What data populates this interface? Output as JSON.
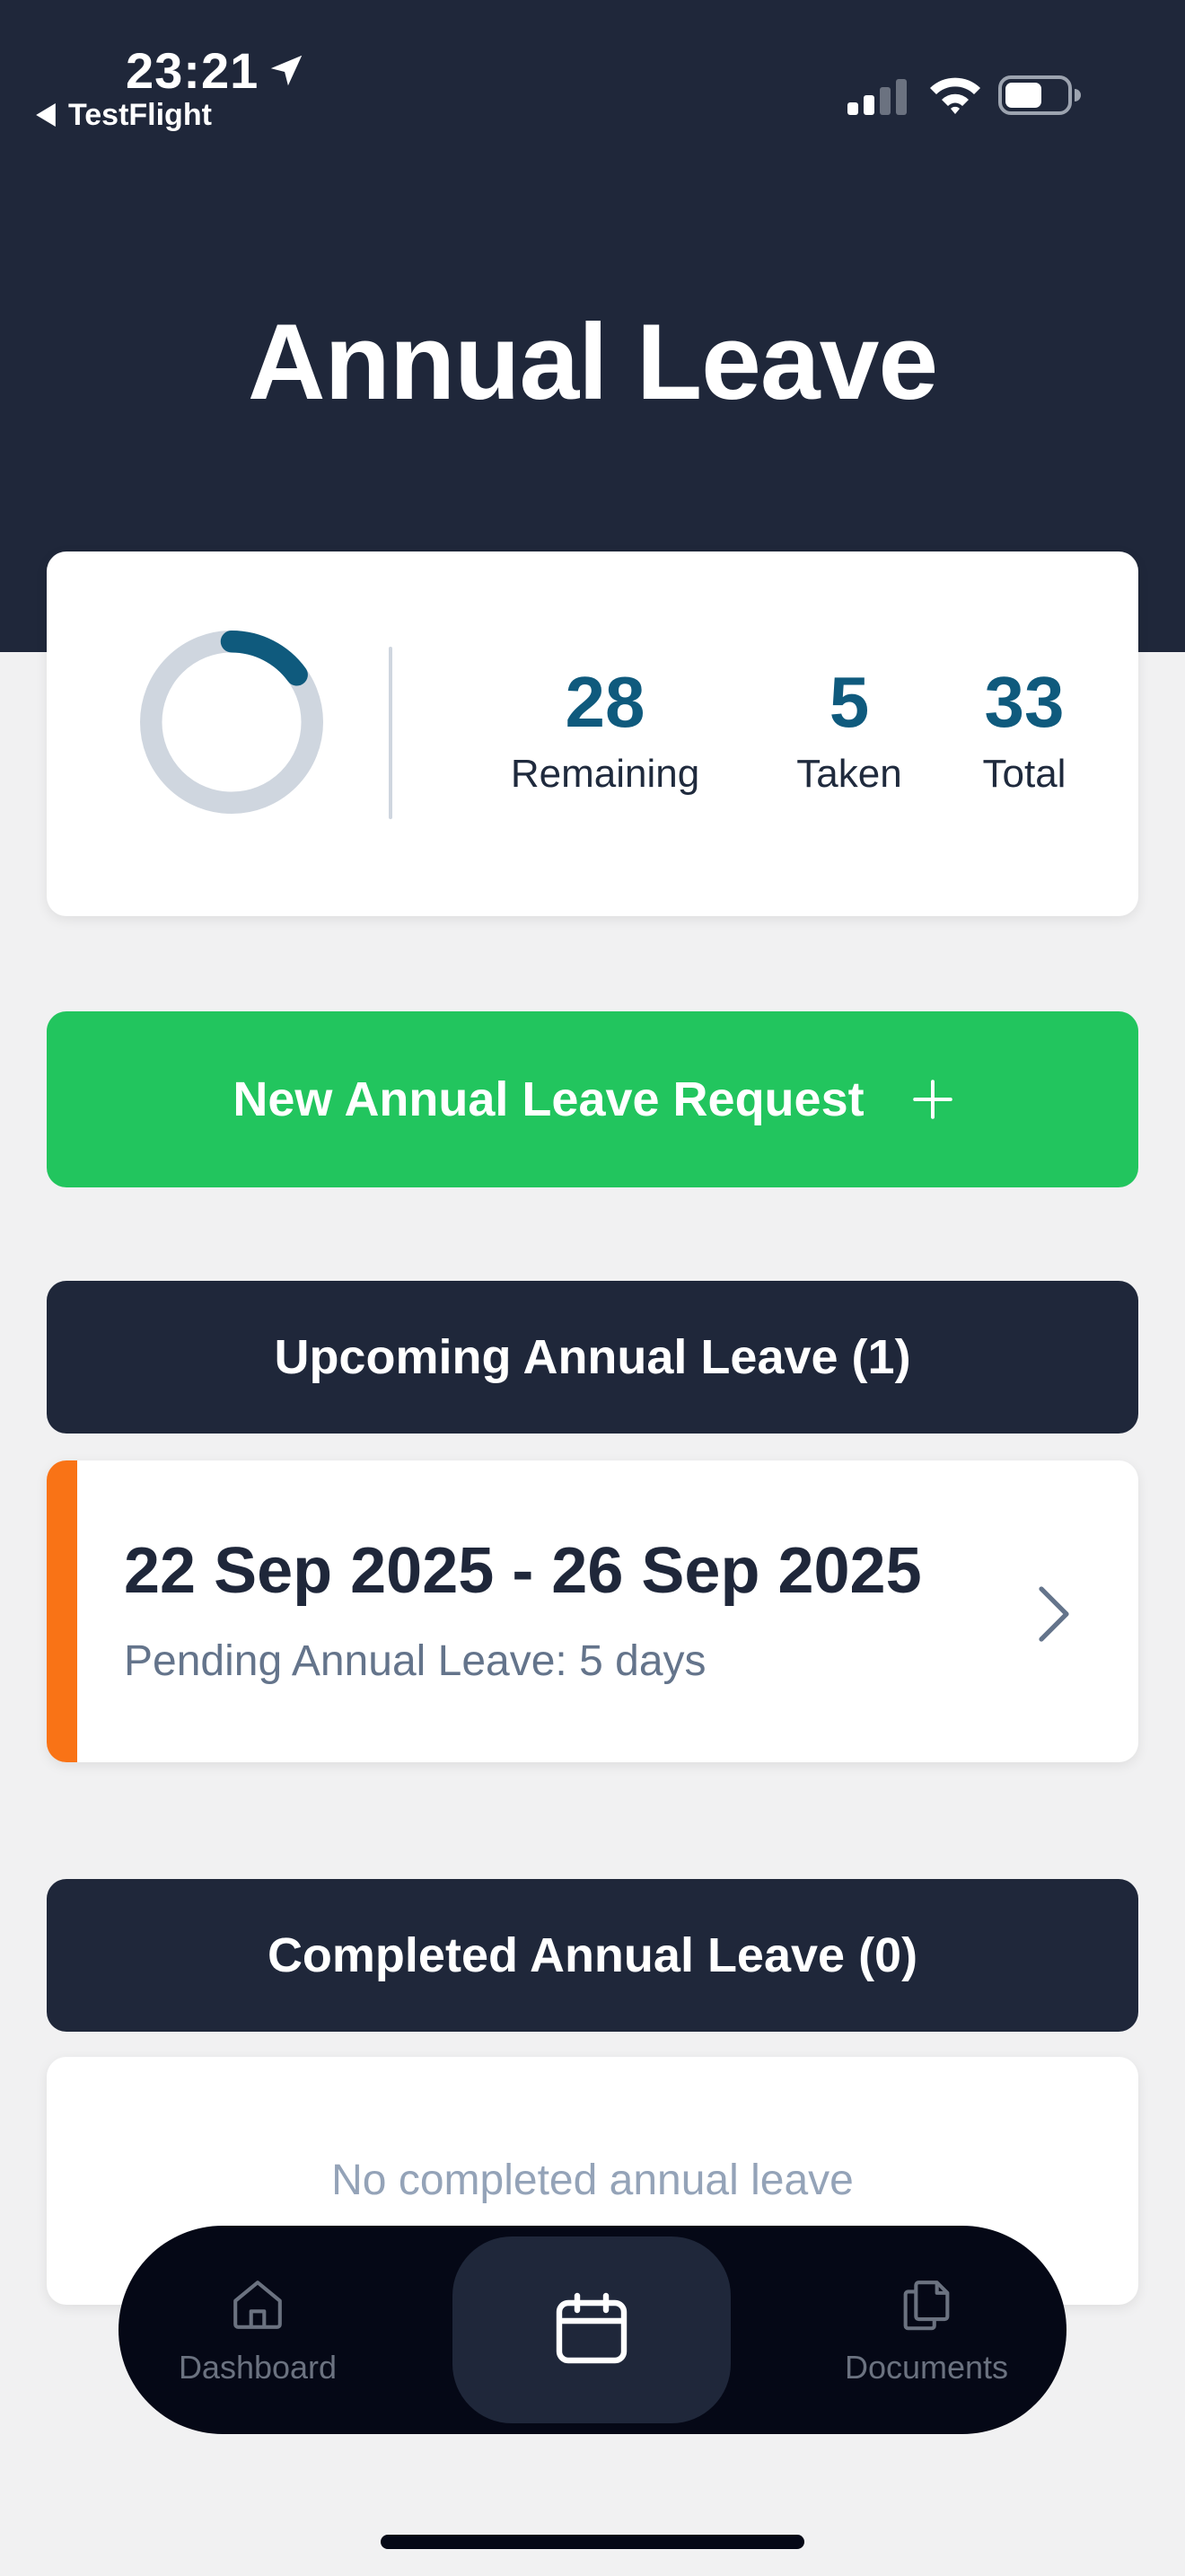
{
  "status_bar": {
    "time": "23:21",
    "back_label": "TestFlight",
    "icons": [
      "location-arrow-icon",
      "signal-icon",
      "wifi-icon",
      "battery-icon"
    ]
  },
  "header": {
    "title": "Annual Leave"
  },
  "summary": {
    "remaining_value": "28",
    "remaining_label": "Remaining",
    "taken_value": "5",
    "taken_label": "Taken",
    "total_value": "33",
    "total_label": "Total",
    "progress_fraction": 0.15,
    "progress_color": "#0f5a7d",
    "track_color": "#cfd6df"
  },
  "new_request": {
    "label": "New Annual Leave Request",
    "icon": "plus-icon",
    "color": "#22c55e"
  },
  "upcoming": {
    "header": "Upcoming Annual Leave (1)",
    "items": [
      {
        "dates": "22 Sep 2025 - 26 Sep 2025",
        "subtitle": "Pending Annual Leave: 5 days",
        "accent_color": "#f97316"
      }
    ]
  },
  "completed": {
    "header": "Completed Annual Leave (0)",
    "empty_text": "No completed annual leave"
  },
  "tab_bar": {
    "items": [
      {
        "label": "Dashboard",
        "icon": "home-icon"
      },
      {
        "label": "",
        "icon": "calendar-icon",
        "active": true
      },
      {
        "label": "Documents",
        "icon": "documents-icon"
      }
    ]
  }
}
